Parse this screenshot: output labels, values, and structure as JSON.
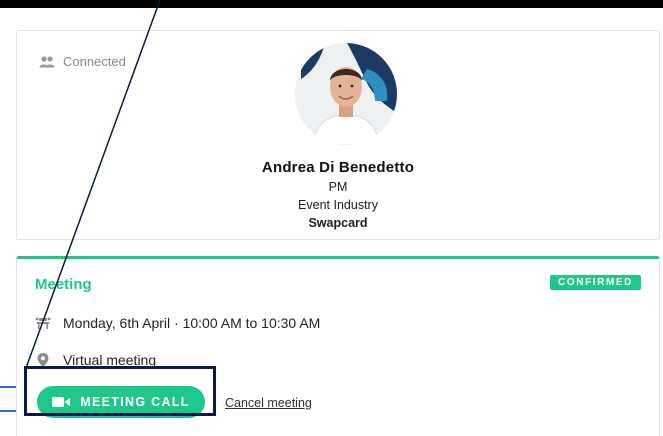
{
  "profile": {
    "connection_status": "Connected",
    "connection_icon": "people-icon",
    "name": "Andrea Di Benedetto",
    "role": "PM",
    "industry": "Event Industry",
    "company": "Swapcard"
  },
  "meeting": {
    "title": "Meeting",
    "status": "CONFIRMED",
    "date_icon": "table-icon",
    "date_time": "Monday, 6th April · 10:00 AM to 10:30 AM",
    "location_icon": "map-pin-icon",
    "location": "Virtual meeting",
    "call_button_label": "MEETING CALL",
    "call_button_icon": "video-camera-icon",
    "cancel_label": "Cancel meeting"
  },
  "colors": {
    "accent": "#1fc88a",
    "highlight": "#0b1a4d",
    "background": "#000000"
  }
}
